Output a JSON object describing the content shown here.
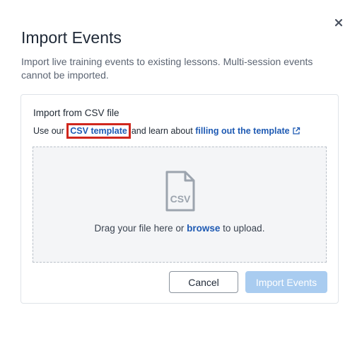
{
  "dialog": {
    "title": "Import Events",
    "description": "Import live training events to existing lessons. Multi-session events cannot be imported."
  },
  "panel": {
    "heading": "Import from CSV file",
    "intro_prefix": "Use our",
    "template_link": "CSV template",
    "intro_middle": "and learn about",
    "guide_link": "filling out the template",
    "file_icon_label": "CSV",
    "drop_prefix": "Drag your file here or",
    "browse_link": "browse",
    "drop_suffix": "to upload."
  },
  "buttons": {
    "cancel": "Cancel",
    "import": "Import Events"
  },
  "icons": {
    "close": "close-icon",
    "external": "external-link-icon",
    "file": "csv-file-icon"
  },
  "colors": {
    "link": "#1e5ab3",
    "highlight": "#d0271d",
    "primary_disabled": "#a9ccf0"
  }
}
